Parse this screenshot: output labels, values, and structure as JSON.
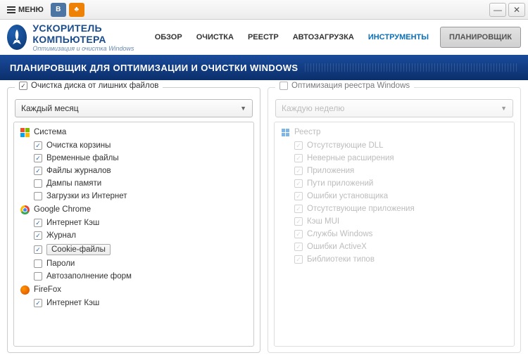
{
  "titlebar": {
    "menu": "МЕНЮ"
  },
  "brand": {
    "title": "УСКОРИТЕЛЬ КОМПЬЮТЕРА",
    "subtitle": "Оптимизация и очистка Windows"
  },
  "nav": {
    "overview": "ОБЗОР",
    "cleaning": "ОЧИСТКА",
    "registry": "РЕЕСТР",
    "autoload": "АВТОЗАГРУЗКА",
    "tools": "ИНСТРУМЕНТЫ",
    "planner": "ПЛАНИРОВЩИК"
  },
  "banner": "ПЛАНИРОВЩИК ДЛЯ ОПТИМИЗАЦИИ И ОЧИСТКИ WINDOWS",
  "left": {
    "title": "Очистка диска от лишних файлов",
    "dropdown": "Каждый месяц",
    "groups": [
      {
        "name": "Система",
        "icon": "windows",
        "items": [
          {
            "label": "Очистка корзины",
            "checked": true
          },
          {
            "label": "Временные файлы",
            "checked": true
          },
          {
            "label": "Файлы журналов",
            "checked": true
          },
          {
            "label": "Дампы памяти",
            "checked": false
          },
          {
            "label": "Загрузки из Интернет",
            "checked": false
          }
        ]
      },
      {
        "name": "Google Chrome",
        "icon": "chrome",
        "items": [
          {
            "label": "Интернет Кэш",
            "checked": true
          },
          {
            "label": "Журнал",
            "checked": true
          },
          {
            "label": "Cookie-файлы",
            "checked": true,
            "highlight": true
          },
          {
            "label": "Пароли",
            "checked": false
          },
          {
            "label": "Автозаполнение форм",
            "checked": false
          }
        ]
      },
      {
        "name": "FireFox",
        "icon": "firefox",
        "items": [
          {
            "label": "Интернет Кэш",
            "checked": true
          }
        ]
      }
    ]
  },
  "right": {
    "title": "Оптимизация реестра Windows",
    "dropdown": "Каждую неделю",
    "groups": [
      {
        "name": "Реестр",
        "icon": "registry",
        "items": [
          {
            "label": "Отсутствующие DLL",
            "checked": true
          },
          {
            "label": "Неверные расширения",
            "checked": true
          },
          {
            "label": "Приложения",
            "checked": true
          },
          {
            "label": "Пути приложений",
            "checked": true
          },
          {
            "label": "Ошибки установщика",
            "checked": true
          },
          {
            "label": "Отсутствующие приложения",
            "checked": true
          },
          {
            "label": "Кэш MUI",
            "checked": true
          },
          {
            "label": "Службы Windows",
            "checked": true
          },
          {
            "label": "Ошибки ActiveX",
            "checked": true
          },
          {
            "label": "Библиотеки типов",
            "checked": true
          }
        ]
      }
    ]
  }
}
